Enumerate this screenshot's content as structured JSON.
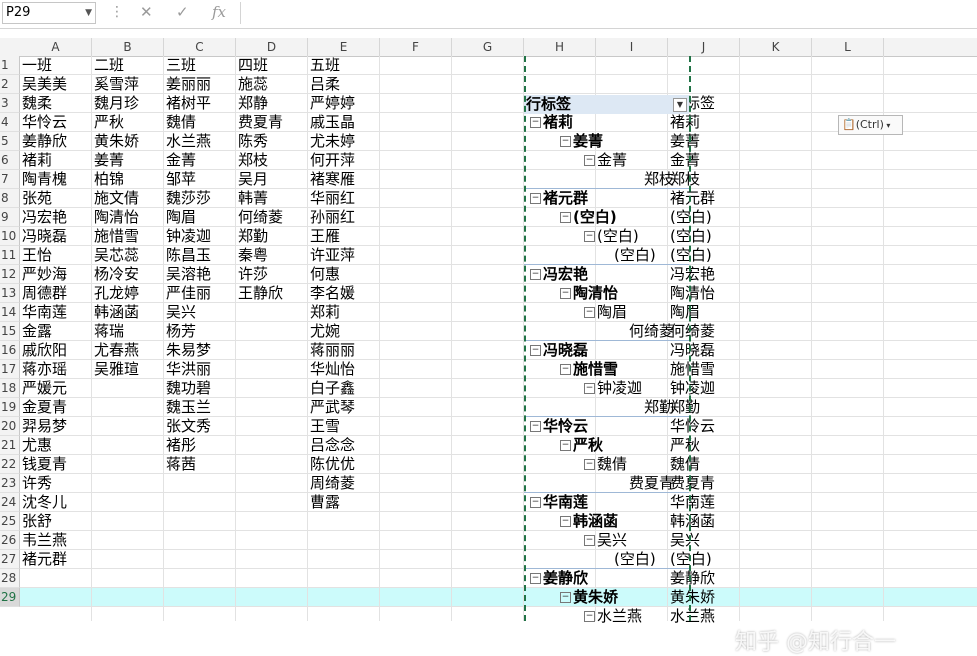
{
  "name_box": "P29",
  "columns": [
    "A",
    "B",
    "C",
    "D",
    "E",
    "F",
    "G",
    "H",
    "I",
    "J",
    "K",
    "L"
  ],
  "rows": [
    "1",
    "2",
    "3",
    "4",
    "5",
    "6",
    "7",
    "8",
    "9",
    "10",
    "11",
    "12",
    "13",
    "14",
    "15",
    "16",
    "17",
    "18",
    "19",
    "20",
    "21",
    "22",
    "23",
    "24",
    "25",
    "26",
    "27",
    "28",
    "29"
  ],
  "table": {
    "A": [
      "一班",
      "吴美美",
      "魏柔",
      "华怜云",
      "姜静欣",
      "褚莉",
      "陶青槐",
      "张苑",
      "冯宏艳",
      "冯晓磊",
      "王怡",
      "严妙海",
      "周德群",
      "华南莲",
      "金露",
      "戚欣阳",
      "蒋亦瑶",
      "严媛元",
      "金夏青",
      "羿易梦",
      "尤惠",
      "钱夏青",
      "许秀",
      "沈冬儿",
      "张舒",
      "韦兰燕",
      "褚元群"
    ],
    "B": [
      "二班",
      "奚雪萍",
      "魏月珍",
      "严秋",
      "黄朱娇",
      "姜菁",
      "柏锦",
      "施文倩",
      "陶清怡",
      "施惜雪",
      "吴芯蕊",
      "杨冷安",
      "孔龙婷",
      "韩涵菡",
      "蒋瑞",
      "尤春燕",
      "吴雅瑄"
    ],
    "C": [
      "三班",
      "姜丽丽",
      "褚树平",
      "魏倩",
      "水兰燕",
      "金菁",
      "邹苹",
      "魏莎莎",
      "陶眉",
      "钟凌迦",
      "陈昌玉",
      "吴溶艳",
      "严佳丽",
      "吴兴",
      "杨芳",
      "朱易梦",
      "华洪丽",
      "魏功碧",
      "魏玉兰",
      "张文秀",
      "褚彤",
      "蒋茜"
    ],
    "D": [
      "四班",
      "施蕊",
      "郑静",
      "费夏青",
      "陈秀",
      "郑枝",
      "吴月",
      "韩菁",
      "何绮菱",
      "郑勤",
      "秦粤",
      "许莎",
      "王静欣"
    ],
    "E": [
      "五班",
      "吕柔",
      "严婷婷",
      "戚玉晶",
      "尤未婷",
      "何开萍",
      "褚寒雁",
      "华丽红",
      "孙丽红",
      "王雁",
      "许亚萍",
      "何惠",
      "李名媛",
      "郑莉",
      "尤婉",
      "蒋丽丽",
      "华灿怡",
      "白子鑫",
      "严武琴",
      "王雪",
      "吕念念",
      "陈优优",
      "周绮菱",
      "曹露"
    ]
  },
  "pivot": {
    "header": "行标签",
    "items": [
      {
        "level": 0,
        "label": "褚莉",
        "toggle": "⊟"
      },
      {
        "level": 1,
        "label": "姜菁",
        "toggle": "⊟"
      },
      {
        "level": 2,
        "label": "金菁",
        "toggle": "⊟"
      },
      {
        "level": 3,
        "label": "郑枝",
        "toggle": ""
      },
      {
        "level": 0,
        "label": "褚元群",
        "toggle": "⊟"
      },
      {
        "level": 1,
        "label": "(空白)",
        "toggle": "⊟"
      },
      {
        "level": 2,
        "label": "(空白)",
        "toggle": "⊟"
      },
      {
        "level": 3,
        "label": "(空白)",
        "toggle": ""
      },
      {
        "level": 0,
        "label": "冯宏艳",
        "toggle": "⊟"
      },
      {
        "level": 1,
        "label": "陶清怡",
        "toggle": "⊟"
      },
      {
        "level": 2,
        "label": "陶眉",
        "toggle": "⊟"
      },
      {
        "level": 3,
        "label": "何绮菱",
        "toggle": ""
      },
      {
        "level": 0,
        "label": "冯晓磊",
        "toggle": "⊟"
      },
      {
        "level": 1,
        "label": "施惜雪",
        "toggle": "⊟"
      },
      {
        "level": 2,
        "label": "钟凌迦",
        "toggle": "⊟"
      },
      {
        "level": 3,
        "label": "郑勤",
        "toggle": ""
      },
      {
        "level": 0,
        "label": "华怜云",
        "toggle": "⊟"
      },
      {
        "level": 1,
        "label": "严秋",
        "toggle": "⊟"
      },
      {
        "level": 2,
        "label": "魏倩",
        "toggle": "⊟"
      },
      {
        "level": 3,
        "label": "费夏青",
        "toggle": ""
      },
      {
        "level": 0,
        "label": "华南莲",
        "toggle": "⊟"
      },
      {
        "level": 1,
        "label": "韩涵菡",
        "toggle": "⊟"
      },
      {
        "level": 2,
        "label": "吴兴",
        "toggle": "⊟"
      },
      {
        "level": 3,
        "label": "(空白)",
        "toggle": ""
      },
      {
        "level": 0,
        "label": "姜静欣",
        "toggle": "⊟"
      },
      {
        "level": 1,
        "label": "黄朱娇",
        "toggle": "⊟"
      },
      {
        "level": 2,
        "label": "水兰燕",
        "toggle": "⊟"
      }
    ]
  },
  "column_J": [
    "行标签",
    "褚莉",
    "姜菁",
    "金菁",
    "郑枝",
    "褚元群",
    "(空白)",
    "(空白)",
    "(空白)",
    "冯宏艳",
    "陶清怡",
    "陶眉",
    "何绮菱",
    "冯晓磊",
    "施惜雪",
    "钟凌迦",
    "郑勤",
    "华怜云",
    "严秋",
    "魏倩",
    "费夏青",
    "华南莲",
    "韩涵菡",
    "吴兴",
    "(空白)",
    "姜静欣",
    "黄朱娇",
    "水兰燕"
  ],
  "paste_button": "(Ctrl)",
  "watermark": "知乎 @知行合一",
  "colors": {
    "selection_row": "#ccfbfb",
    "pivot_header": "#dde8f4",
    "copy_border": "#217346"
  }
}
